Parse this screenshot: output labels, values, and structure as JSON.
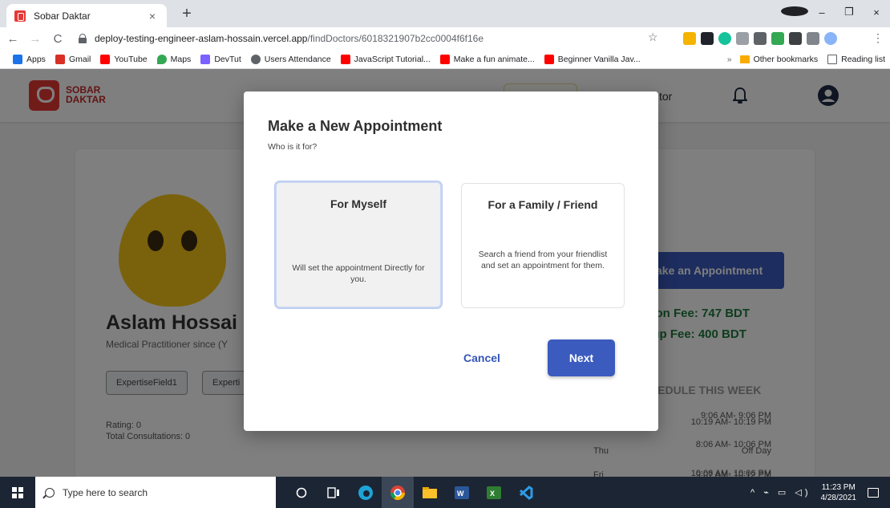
{
  "browser": {
    "tab_title": "Sobar Daktar",
    "tab_close": "×",
    "new_tab": "+",
    "win_minimize": "–",
    "win_restore": "❐",
    "win_close": "×",
    "url_host": "deploy-testing-engineer-aslam-hossain.vercel.app",
    "url_path": "/findDoctors/6018321907b2cc0004f6f16e",
    "bookmarks": [
      {
        "label": "Apps",
        "icon": "apps-grid-icon",
        "color": "#1a73e8"
      },
      {
        "label": "Gmail",
        "icon": "gmail-icon",
        "color": "#d93025"
      },
      {
        "label": "YouTube",
        "icon": "youtube-icon",
        "color": "#ff0000"
      },
      {
        "label": "Maps",
        "icon": "maps-icon",
        "color": "#34a853"
      },
      {
        "label": "DevTut",
        "icon": "devtut-icon",
        "color": "#7b61ff"
      },
      {
        "label": "Users Attendance",
        "icon": "globe-icon",
        "color": "#5f6368"
      },
      {
        "label": "JavaScript Tutorial...",
        "icon": "youtube-icon",
        "color": "#ff0000"
      },
      {
        "label": "Make a fun animate...",
        "icon": "youtube-icon",
        "color": "#ff0000"
      },
      {
        "label": "Beginner Vanilla Jav...",
        "icon": "youtube-icon",
        "color": "#ff0000"
      }
    ],
    "bookmarks_overflow": "»",
    "other_bookmarks": "Other bookmarks",
    "reading_list": "Reading list"
  },
  "app": {
    "logo_line1": "SOBAR",
    "logo_line2": "DAKTAR",
    "nav_link": "tor"
  },
  "doctor": {
    "name": "Aslam Hossai",
    "since": "Medical Practitioner since (Y",
    "expertise": [
      "ExpertiseField1",
      "Experti"
    ],
    "rating": "Rating: 0",
    "consultations": "Total Consultations: 0",
    "appointment_button": "ake an Appointment",
    "consultation_fee": "ation Fee: 747 BDT",
    "followup_fee": "v-up Fee: 400 BDT",
    "schedule_title": "CHEDULE THIS WEEK",
    "schedule": [
      {
        "day": "",
        "time": "9:06 AM- 9:06 PM"
      },
      {
        "day": "",
        "time": "8:06 AM- 10:06 PM"
      },
      {
        "day": "",
        "time": "10:06 AM- 10:06 PM"
      },
      {
        "day": "",
        "time": "10:19 AM- 10:19 PM"
      },
      {
        "day": "Thu",
        "time": "Off Day"
      },
      {
        "day": "Fri",
        "time": "9:07 AM- 10:12 PM"
      }
    ]
  },
  "modal": {
    "title": "Make a New Appointment",
    "subtitle": "Who is it for?",
    "option_myself": {
      "title": "For Myself",
      "desc": "Will set the appointment Directly for you."
    },
    "option_friend": {
      "title": "For a Family / Friend",
      "desc": "Search a friend from your friendlist and set an appointment for them."
    },
    "cancel": "Cancel",
    "next": "Next"
  },
  "taskbar": {
    "search_placeholder": "Type here to search",
    "time": "11:23 PM",
    "date": "4/28/2021",
    "tray_glyphs": "^ ⌁ ▭ ◁)"
  }
}
